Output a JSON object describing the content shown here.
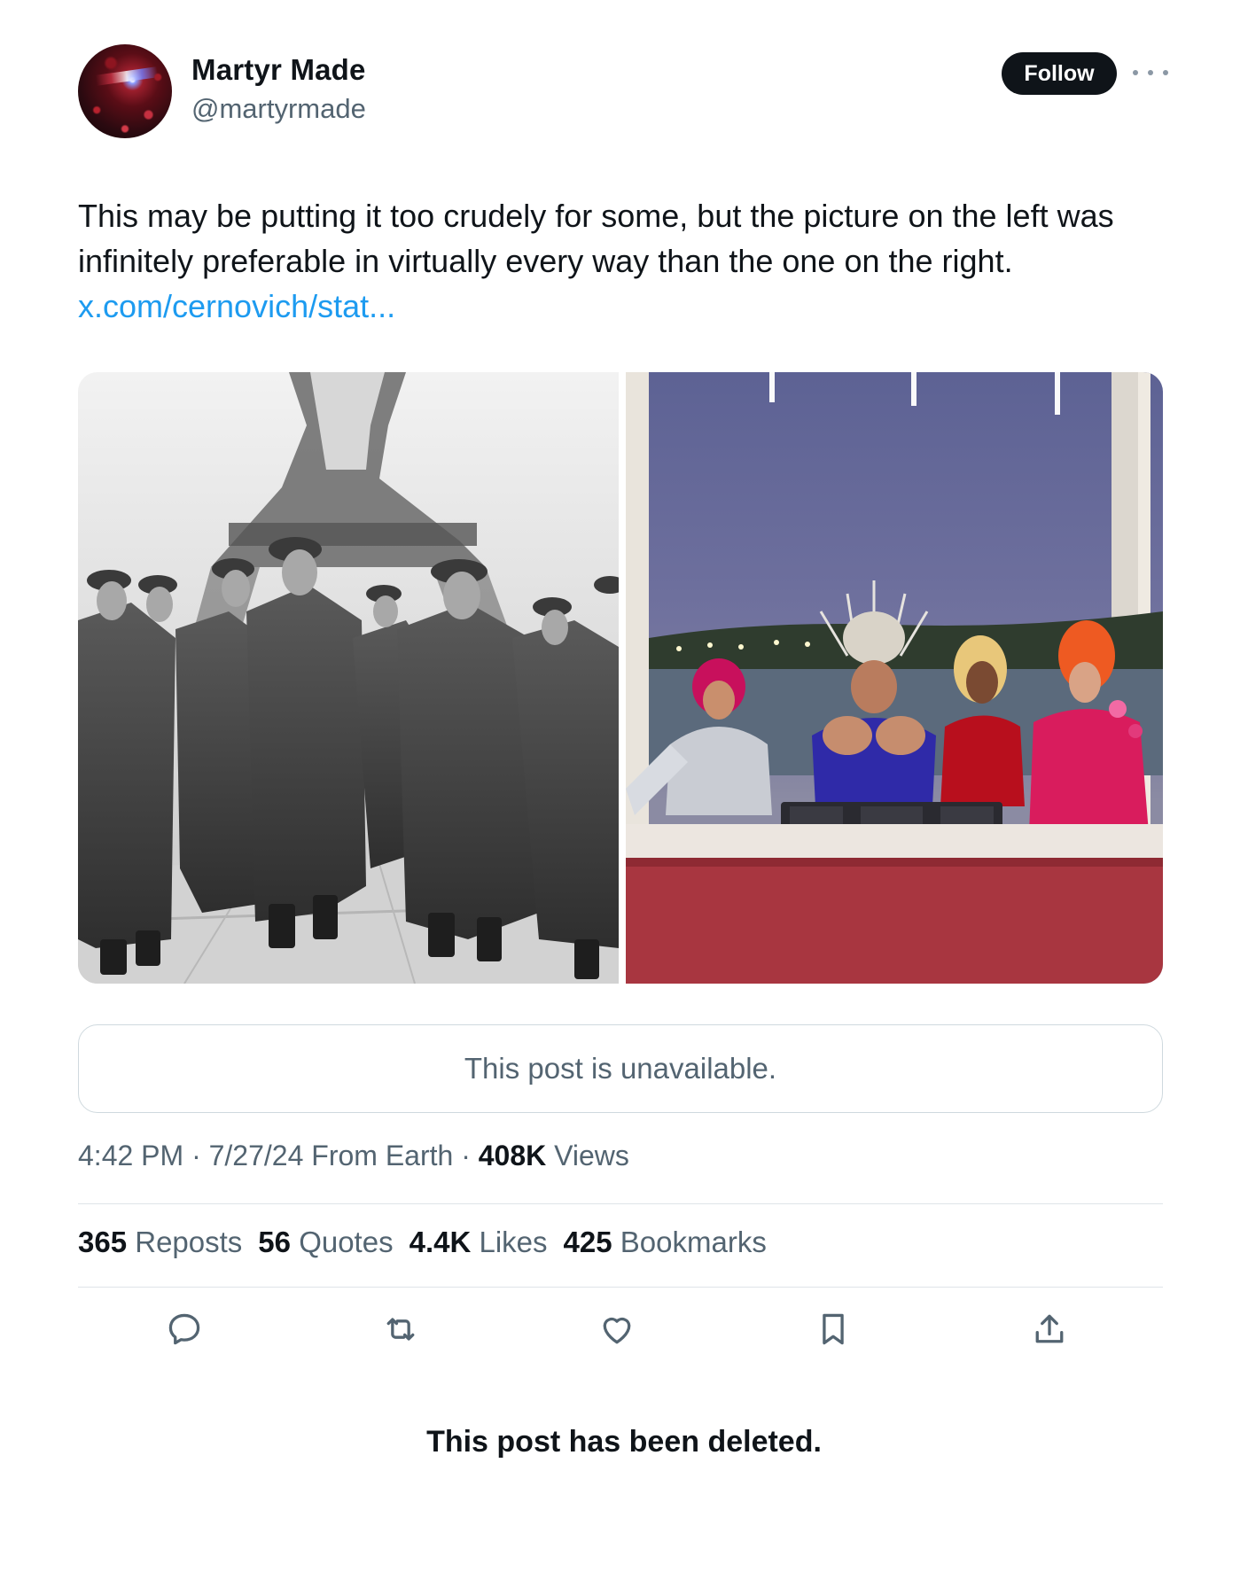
{
  "author": {
    "display_name": "Martyr Made",
    "handle": "@martyrmade",
    "follow_label": "Follow"
  },
  "post": {
    "text": "This may be putting it too crudely for some, but the picture on the left was infinitely preferable in virtually every way than the one on the right.",
    "link": "x.com/cernovich/stat..."
  },
  "quoted_post": {
    "message": "This post is unavailable."
  },
  "meta": {
    "time": "4:42 PM",
    "date": "7/27/24",
    "source": "From Earth",
    "views_count": "408K",
    "views_label": "Views"
  },
  "engagement": {
    "reposts_count": "365",
    "reposts_label": "Reposts",
    "quotes_count": "56",
    "quotes_label": "Quotes",
    "likes_count": "4.4K",
    "likes_label": "Likes",
    "bookmarks_count": "425",
    "bookmarks_label": "Bookmarks"
  },
  "actions": [
    "reply-icon",
    "repost-icon",
    "like-icon",
    "bookmark-icon",
    "share-icon"
  ],
  "footer": {
    "deleted_notice": "This post has been deleted."
  },
  "colors": {
    "link": "#1d9bf0",
    "text": "#0f1419",
    "secondary": "#536471",
    "follow_bg": "#0f1419"
  }
}
